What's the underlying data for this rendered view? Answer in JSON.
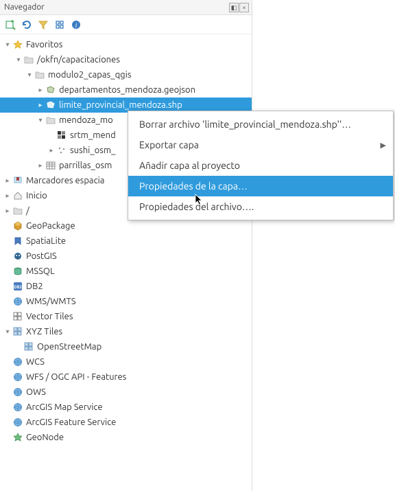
{
  "panel": {
    "title": "Navegador"
  },
  "tree": {
    "favoritos": "Favoritos",
    "okfn": "/okfn/capacitaciones",
    "modulo2": "modulo2_capas_qgis",
    "departamentos": "departamentos_mendoza.geojson",
    "limite": "limite_provincial_mendoza.shp",
    "mendoza_mo": "mendoza_mo",
    "srtm": "srtm_mend",
    "sushi": "sushi_osm_",
    "parrillas": "parrillas_osm",
    "marcadores": "Marcadores espacia",
    "inicio": "Inicio",
    "root": "/",
    "geopackage": "GeoPackage",
    "spatialite": "SpatiaLite",
    "postgis": "PostGIS",
    "mssql": "MSSQL",
    "db2": "DB2",
    "wms": "WMS/WMTS",
    "vectortiles": "Vector Tiles",
    "xyz": "XYZ Tiles",
    "osm": "OpenStreetMap",
    "wcs": "WCS",
    "wfs": "WFS / OGC API - Features",
    "ows": "OWS",
    "arcgismap": "ArcGIS Map Service",
    "arcgisfeature": "ArcGIS Feature Service",
    "geonode": "GeoNode"
  },
  "context_menu": {
    "borrar": "Borrar archivo 'limite_provincial_mendoza.shp''…",
    "exportar": "Exportar capa",
    "anadir": "Añadir capa al proyecto",
    "propiedades_capa": "Propiedades de la capa…",
    "propiedades_archivo": "Propiedades del archivo…."
  }
}
